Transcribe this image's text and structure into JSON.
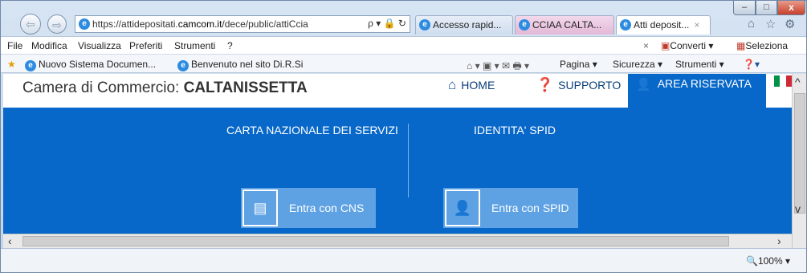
{
  "browser": {
    "window_controls": {
      "minimize": "–",
      "maximize": "□",
      "close": "x"
    },
    "nav": {
      "back_icon": "⇦",
      "forward_icon": "⇨"
    },
    "address": {
      "url_prefix": "https://attidepositati.",
      "url_domain": "camcom.it",
      "url_suffix": "/dece/public/attiCcia",
      "icons": "ρ ▾ 🔒 ↻"
    },
    "tabs": [
      {
        "label": "Accesso rapid...",
        "active": false
      },
      {
        "label": "CCIAA CALTA...",
        "active": false
      },
      {
        "label": "Atti deposit...",
        "active": true
      }
    ],
    "tab_close": "×",
    "toolbar_icons": {
      "home": "⌂",
      "star": "☆",
      "gear": "⚙"
    },
    "menu": [
      "File",
      "Modifica",
      "Visualizza",
      "Preferiti",
      "Strumenti",
      "?"
    ],
    "menu_right": {
      "close": "×",
      "converti": "Converti",
      "converti_arrow": "▾",
      "seleziona": "Seleziona"
    },
    "favorites": [
      {
        "label": "Nuovo Sistema Documen..."
      },
      {
        "label": "Benvenuto nel sito Di.R.Si"
      }
    ],
    "command_bar": [
      "Pagina ▾",
      "Sicurezza ▾",
      "Strumenti ▾"
    ],
    "zoom": "100%"
  },
  "site": {
    "camera_prefix": "Camera di Commercio: ",
    "camera_name": "CALTANISSETTA",
    "nav": {
      "home": "HOME",
      "supporto": "SUPPORTO",
      "area_riservata": "AREA RISERVATA"
    },
    "cns": {
      "title": "CARTA NAZIONALE DEI SERVIZI",
      "button": "Entra con CNS"
    },
    "spid": {
      "title": "IDENTITA' SPID",
      "button": "Entra con SPID"
    },
    "colors": {
      "brand_blue": "#0768c9",
      "button_blue": "#5ea2e3"
    }
  }
}
